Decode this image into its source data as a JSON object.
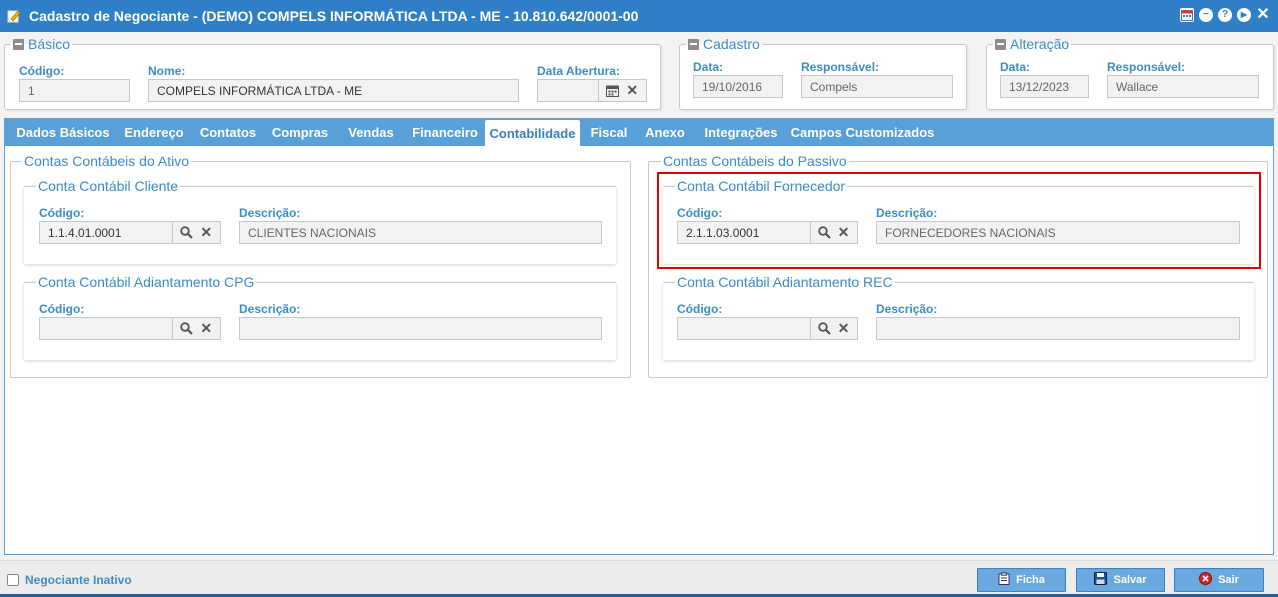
{
  "window": {
    "title": "Cadastro de Negociante - (DEMO) COMPELS INFORMÁTICA LTDA - ME - 10.810.642/0001-00",
    "help_label": "?",
    "next_label": "▶",
    "minimize_label": "−",
    "close_label": "✕"
  },
  "basico": {
    "legend": "Básico",
    "codigo_label": "Código:",
    "codigo_value": "1",
    "nome_label": "Nome:",
    "nome_value": "COMPELS INFORMÁTICA LTDA - ME",
    "data_abertura_label": "Data Abertura:",
    "data_abertura_value": ""
  },
  "cadastro": {
    "legend": "Cadastro",
    "data_label": "Data:",
    "data_value": "19/10/2016",
    "responsavel_label": "Responsável:",
    "responsavel_value": "Compels"
  },
  "alteracao": {
    "legend": "Alteração",
    "data_label": "Data:",
    "data_value": "13/12/2023",
    "responsavel_label": "Responsável:",
    "responsavel_value": "Wallace"
  },
  "tabs": [
    {
      "label": "Dados Básicos"
    },
    {
      "label": "Endereço"
    },
    {
      "label": "Contatos"
    },
    {
      "label": "Compras"
    },
    {
      "label": "Vendas"
    },
    {
      "label": "Financeiro"
    },
    {
      "label": "Contabilidade",
      "active": true
    },
    {
      "label": "Fiscal"
    },
    {
      "label": "Anexo"
    },
    {
      "label": "Integrações"
    },
    {
      "label": "Campos Customizados"
    }
  ],
  "ativo": {
    "legend": "Contas Contábeis do Ativo",
    "cliente": {
      "legend": "Conta Contábil Cliente",
      "codigo_label": "Código:",
      "codigo_value": "1.1.4.01.0001",
      "descricao_label": "Descrição:",
      "descricao_value": "CLIENTES NACIONAIS"
    },
    "adiantamento": {
      "legend": "Conta Contábil Adiantamento CPG",
      "codigo_label": "Código:",
      "codigo_value": "",
      "descricao_label": "Descrição:",
      "descricao_value": ""
    }
  },
  "passivo": {
    "legend": "Contas Contábeis do Passivo",
    "fornecedor": {
      "legend": "Conta Contábil Fornecedor",
      "codigo_label": "Código:",
      "codigo_value": "2.1.1.03.0001",
      "descricao_label": "Descrição:",
      "descricao_value": "FORNECEDORES NACIONAIS"
    },
    "adiantamento": {
      "legend": "Conta Contábil Adiantamento REC",
      "codigo_label": "Código:",
      "codigo_value": "",
      "descricao_label": "Descrição:",
      "descricao_value": ""
    }
  },
  "footer": {
    "inativo_label": "Negociante Inativo",
    "ficha_label": "Ficha",
    "salvar_label": "Salvar",
    "sair_label": "Sair"
  },
  "colors": {
    "titlebar": "#2f7fc7",
    "tabbar": "#5aa0d8",
    "label": "#3d8cc6",
    "highlight": "#e00000",
    "button": "#6aa8dd"
  }
}
